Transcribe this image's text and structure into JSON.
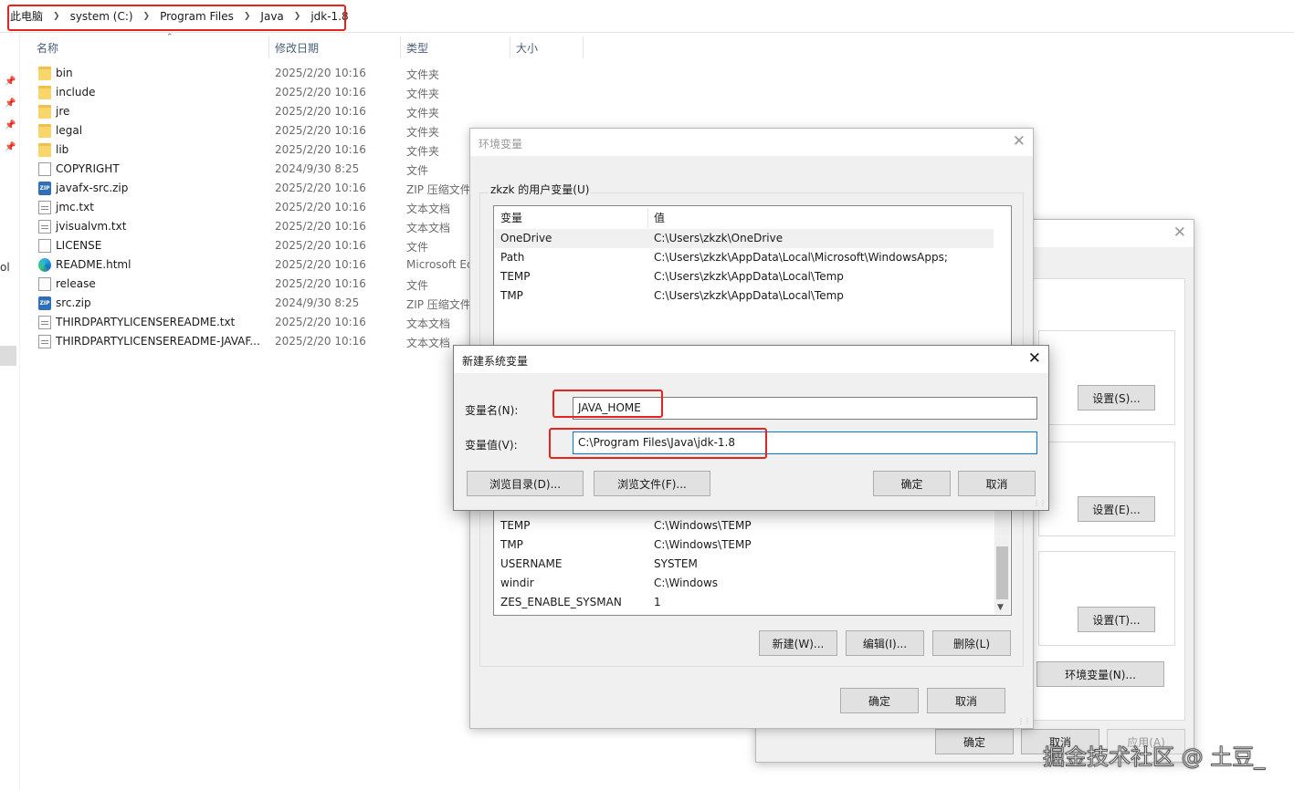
{
  "explorer": {
    "breadcrumb": [
      "此电脑",
      "system (C:)",
      "Program Files",
      "Java",
      "jdk-1.8"
    ],
    "columns": {
      "name": "名称",
      "modified": "修改日期",
      "type": "类型",
      "size": "大小"
    },
    "left_pane_text": "ol",
    "files": [
      {
        "name": "bin",
        "date": "2025/2/20 10:16",
        "type": "文件夹",
        "icon": "folder-icon"
      },
      {
        "name": "include",
        "date": "2025/2/20 10:16",
        "type": "文件夹",
        "icon": "folder-icon"
      },
      {
        "name": "jre",
        "date": "2025/2/20 10:16",
        "type": "文件夹",
        "icon": "folder-icon"
      },
      {
        "name": "legal",
        "date": "2025/2/20 10:16",
        "type": "文件夹",
        "icon": "folder-icon"
      },
      {
        "name": "lib",
        "date": "2025/2/20 10:16",
        "type": "文件夹",
        "icon": "folder-icon"
      },
      {
        "name": "COPYRIGHT",
        "date": "2024/9/30 8:25",
        "type": "文件",
        "icon": "file-icon"
      },
      {
        "name": "javafx-src.zip",
        "date": "2025/2/20 10:16",
        "type": "ZIP 压缩文件",
        "icon": "zip-icon"
      },
      {
        "name": "jmc.txt",
        "date": "2025/2/20 10:16",
        "type": "文本文档",
        "icon": "text-file-icon"
      },
      {
        "name": "jvisualvm.txt",
        "date": "2025/2/20 10:16",
        "type": "文本文档",
        "icon": "text-file-icon"
      },
      {
        "name": "LICENSE",
        "date": "2025/2/20 10:16",
        "type": "文件",
        "icon": "file-icon"
      },
      {
        "name": "README.html",
        "date": "2025/2/20 10:16",
        "type": "Microsoft Ec",
        "icon": "edge-icon"
      },
      {
        "name": "release",
        "date": "2025/2/20 10:16",
        "type": "文件",
        "icon": "file-icon"
      },
      {
        "name": "src.zip",
        "date": "2024/9/30 8:25",
        "type": "ZIP 压缩文件",
        "icon": "zip-icon"
      },
      {
        "name": "THIRDPARTYLICENSEREADME.txt",
        "date": "2025/2/20 10:16",
        "type": "文本文档",
        "icon": "text-file-icon"
      },
      {
        "name": "THIRDPARTYLICENSEREADME-JAVAF...",
        "date": "2025/2/20 10:16",
        "type": "文本文档",
        "icon": "text-file-icon"
      }
    ]
  },
  "sysprops": {
    "settings_buttons": [
      "设置(S)...",
      "设置(E)...",
      "设置(T)..."
    ],
    "env_button": "环境变量(N)...",
    "ok": "确定",
    "cancel": "取消",
    "apply": "应用(A)"
  },
  "envvars": {
    "title": "环境变量",
    "user_group_label": "zkzk 的用户变量(U)",
    "col_var": "变量",
    "col_val": "值",
    "user_vars": [
      {
        "name": "OneDrive",
        "value": "C:\\Users\\zkzk\\OneDrive"
      },
      {
        "name": "Path",
        "value": "C:\\Users\\zkzk\\AppData\\Local\\Microsoft\\WindowsApps;"
      },
      {
        "name": "TEMP",
        "value": "C:\\Users\\zkzk\\AppData\\Local\\Temp"
      },
      {
        "name": "TMP",
        "value": "C:\\Users\\zkzk\\AppData\\Local\\Temp"
      }
    ],
    "system_vars": [
      {
        "name": "TEMP",
        "value": "C:\\Windows\\TEMP"
      },
      {
        "name": "TMP",
        "value": "C:\\Windows\\TEMP"
      },
      {
        "name": "USERNAME",
        "value": "SYSTEM"
      },
      {
        "name": "windir",
        "value": "C:\\Windows"
      },
      {
        "name": "ZES_ENABLE_SYSMAN",
        "value": "1"
      }
    ],
    "new_btn": "新建(W)...",
    "edit_btn": "编辑(I)...",
    "delete_btn": "删除(L)",
    "ok": "确定",
    "cancel": "取消"
  },
  "newvar": {
    "title": "新建系统变量",
    "name_label": "变量名(N):",
    "value_label": "变量值(V):",
    "name_value": "JAVA_HOME",
    "value_value": "C:\\Program Files\\Java\\jdk-1.8",
    "browse_dir": "浏览目录(D)...",
    "browse_file": "浏览文件(F)...",
    "ok": "确定",
    "cancel": "取消"
  },
  "watermark": "掘金技术社区 @ 土豆_",
  "colors": {
    "highlight": "#e8231b",
    "focus": "#0078d7"
  }
}
